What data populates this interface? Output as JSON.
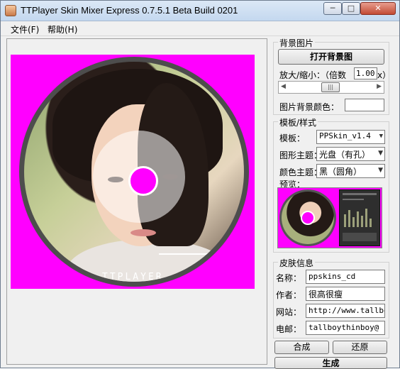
{
  "window": {
    "title": "TTPlayer Skin Mixer Express 0.7.5.1 Beta Build 0201",
    "controls": {
      "minimize": "─",
      "maximize": "□",
      "close": "✕"
    }
  },
  "menu": {
    "items": [
      "文件(F)",
      "帮助(H)"
    ]
  },
  "canvas": {
    "disc_logo": "TTPLAYER",
    "background_color": "#ff00ff"
  },
  "background_group": {
    "title": "背景图片",
    "open_button": "打开背景图",
    "zoom_label": "放大/缩小：（倍数",
    "zoom_value": "1.00",
    "zoom_suffix": "x）",
    "slider_grip": "|||",
    "bg_color_label": "图片背景颜色："
  },
  "template_group": {
    "title": "模板/样式",
    "template_label": "模板：",
    "template_value": "PPSkin_v1.4",
    "shape_label": "图形主题：",
    "shape_value": "光盘（有孔）",
    "color_label": "颜色主题：",
    "color_value": "黑（圆角）",
    "preview_label": "预览："
  },
  "skin_info": {
    "title": "皮肤信息",
    "name_label": "名称：",
    "name_value": "ppskins_cd",
    "author_label": "作者：",
    "author_value": "很高很瘦",
    "site_label": "网站：",
    "site_value": "http://www.tallboythinboy.com",
    "email_label": "电邮：",
    "email_value": "tallboythinboy@"
  },
  "actions": {
    "compose": "合成",
    "restore": "还原",
    "generate": "生成"
  },
  "icons": [
    "app-icon",
    "minimize-icon",
    "maximize-icon",
    "close-icon",
    "chevron-down-icon",
    "chevron-left-icon",
    "chevron-right-icon"
  ]
}
